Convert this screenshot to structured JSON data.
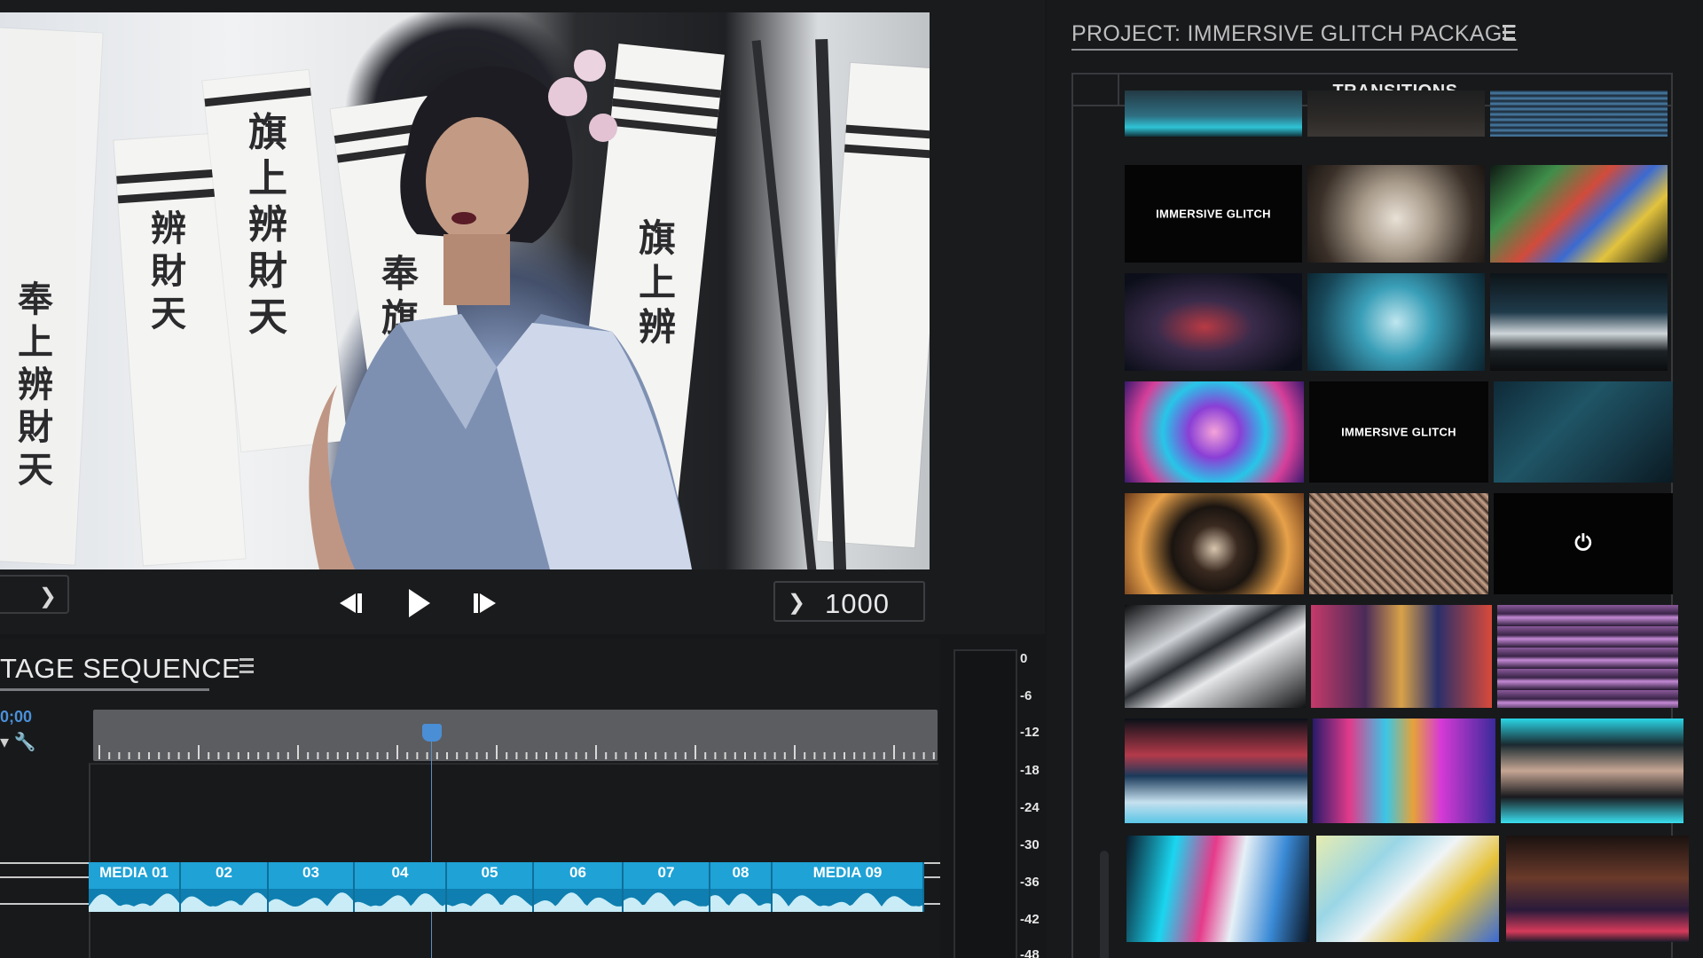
{
  "transport": {
    "frame_value": "1000"
  },
  "timeline": {
    "title": "TAGE SEQUENCE",
    "timecode": "0;00",
    "clips": [
      "MEDIA 01",
      "02",
      "03",
      "04",
      "05",
      "06",
      "07",
      "08",
      "MEDIA 09"
    ]
  },
  "meter": {
    "db_labels": [
      "0",
      "-6",
      "-12",
      "-18",
      "-24",
      "-30",
      "-36",
      "-42",
      "-48"
    ]
  },
  "project": {
    "title": "PROJECT: IMMERSIVE GLITCH PACKAGE",
    "bin_title": "TRANSITIONS",
    "thumbnails": [
      {
        "label": ""
      },
      {
        "label": ""
      },
      {
        "label": ""
      },
      {
        "label": "IMMERSIVE GLITCH"
      },
      {
        "label": ""
      },
      {
        "label": ""
      },
      {
        "label": ""
      },
      {
        "label": ""
      },
      {
        "label": ""
      },
      {
        "label": ""
      },
      {
        "label": "IMMERSIVE GLITCH"
      },
      {
        "label": ""
      },
      {
        "label": ""
      },
      {
        "label": ""
      },
      {
        "label": ""
      },
      {
        "label": ""
      },
      {
        "label": ""
      },
      {
        "label": ""
      },
      {
        "label": ""
      },
      {
        "label": ""
      },
      {
        "label": ""
      },
      {
        "label": ""
      },
      {
        "label": ""
      },
      {
        "label": ""
      }
    ]
  },
  "colors": {
    "accent": "#4a8ed6",
    "clip": "#1fa2d6",
    "panel": "#18191b"
  }
}
